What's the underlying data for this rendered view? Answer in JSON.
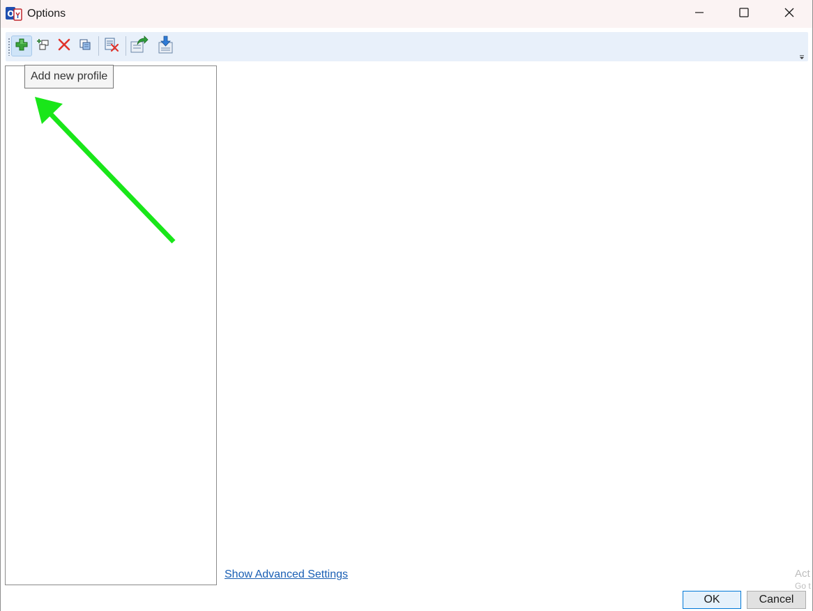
{
  "window": {
    "title": "Options",
    "app_icon": "outlook-sync-app-icon",
    "controls": {
      "minimize_icon": "minimize-icon",
      "maximize_icon": "maximize-icon",
      "close_icon": "close-icon"
    }
  },
  "toolbar": {
    "buttons": [
      {
        "name": "add-profile",
        "icon": "green-plus-icon"
      },
      {
        "name": "add-group",
        "icon": "add-group-icon"
      },
      {
        "name": "delete",
        "icon": "red-x-icon"
      },
      {
        "name": "copy",
        "icon": "copy-icon"
      },
      {
        "name": "clear",
        "icon": "clear-list-icon"
      },
      {
        "name": "export",
        "icon": "export-icon"
      },
      {
        "name": "import",
        "icon": "import-icon"
      }
    ],
    "tooltip": "Add new profile"
  },
  "main": {
    "advanced_link": "Show Advanced Settings"
  },
  "watermark": {
    "line1": "Act",
    "line2": "Go t"
  },
  "dialog": {
    "ok_label": "OK",
    "cancel_label": "Cancel"
  },
  "colors": {
    "annotation_arrow": "#19e619",
    "link": "#1a5fb4",
    "toolbar_bg": "#e8f0fa",
    "titlebar_bg": "#fbf3f3"
  }
}
